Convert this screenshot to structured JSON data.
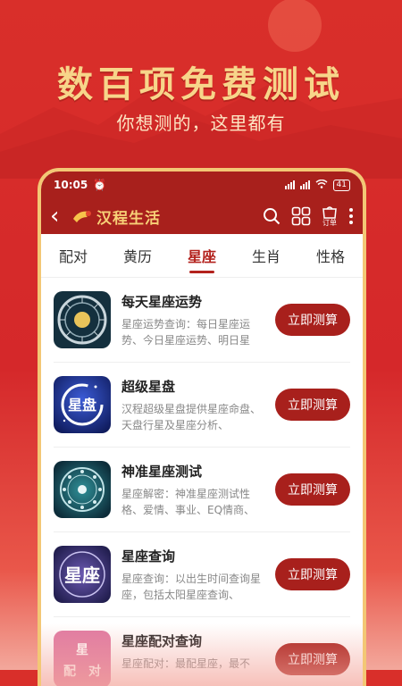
{
  "hero": {
    "title": "数百项免费测试",
    "subtitle": "你想测的，这里都有"
  },
  "status": {
    "time": "10:05",
    "battery": "41"
  },
  "app": {
    "logo_text": "汉程生活",
    "order_label": "订单"
  },
  "tabs": [
    {
      "label": "配对",
      "active": false
    },
    {
      "label": "黄历",
      "active": false
    },
    {
      "label": "星座",
      "active": true
    },
    {
      "label": "生肖",
      "active": false
    },
    {
      "label": "性格",
      "active": false
    }
  ],
  "items": [
    {
      "title": "每天星座运势",
      "desc": "星座运势查询：每日星座运势、今日星座运势、明日星",
      "cta": "立即测算",
      "icon": "zodiac-wheel-icon"
    },
    {
      "title": "超级星盘",
      "desc": "汉程超级星盘提供星座命盘、天盘行星及星座分析、",
      "cta": "立即测算",
      "icon": "star-chart-icon"
    },
    {
      "title": "神准星座测试",
      "desc": "星座解密：神准星座测试性格、爱情、事业、EQ情商、",
      "cta": "立即测算",
      "icon": "zodiac-ring-icon"
    },
    {
      "title": "星座查询",
      "desc": "星座查询：以出生时间查询星座，包括太阳星座查询、",
      "cta": "立即测算",
      "icon": "constellation-query-icon"
    },
    {
      "title": "星座配对查询",
      "desc": "星座配对：最配星座，最不",
      "cta": "立即测算",
      "icon": "pairing-icon"
    }
  ],
  "colors": {
    "brand_red": "#a8201c",
    "gold": "#f3c775",
    "accent": "#b3221d"
  }
}
